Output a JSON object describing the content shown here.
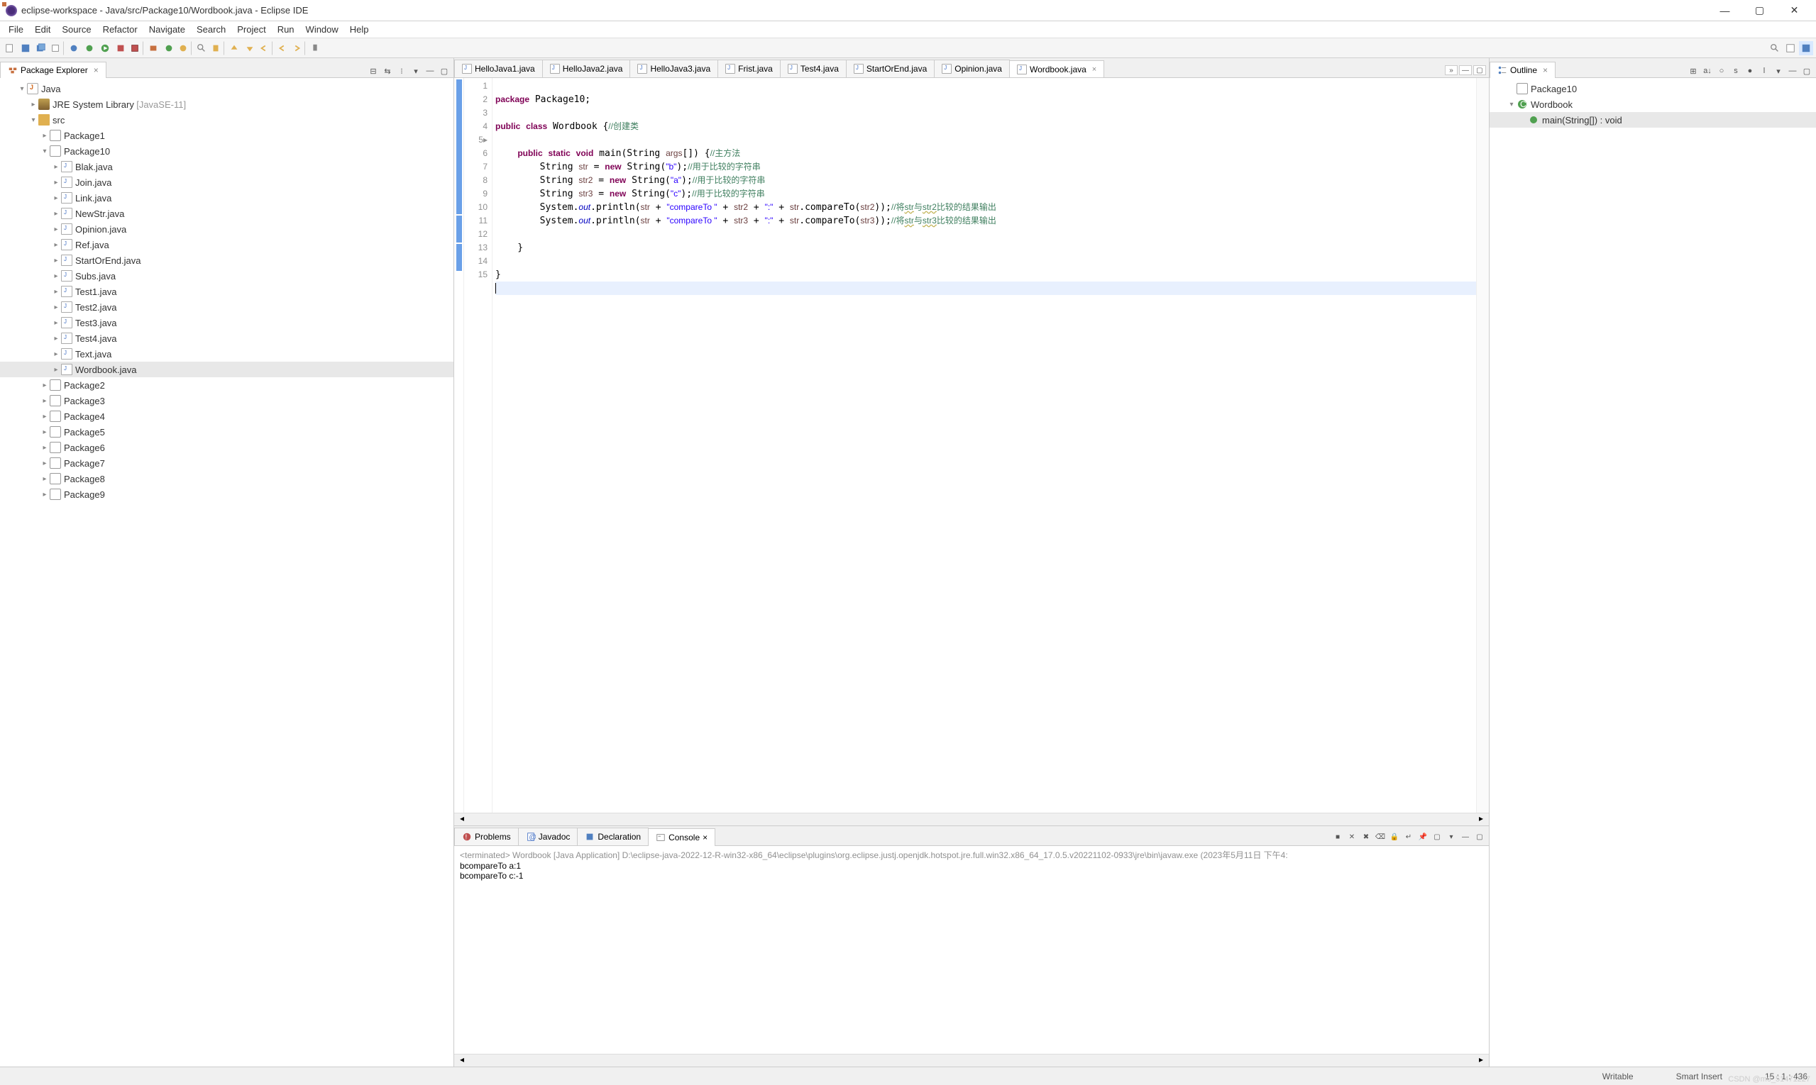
{
  "titlebar": {
    "title": "eclipse-workspace - Java/src/Package10/Wordbook.java - Eclipse IDE"
  },
  "menubar": [
    "File",
    "Edit",
    "Source",
    "Refactor",
    "Navigate",
    "Search",
    "Project",
    "Run",
    "Window",
    "Help"
  ],
  "package_explorer": {
    "title": "Package Explorer",
    "project": "Java",
    "jre": {
      "label": "JRE System Library",
      "suffix": "[JavaSE-11]"
    },
    "src": "src",
    "packages_above": [
      "Package1"
    ],
    "open_package": "Package10",
    "files": [
      "Blak.java",
      "Join.java",
      "Link.java",
      "NewStr.java",
      "Opinion.java",
      "Ref.java",
      "StartOrEnd.java",
      "Subs.java",
      "Test1.java",
      "Test2.java",
      "Test3.java",
      "Test4.java",
      "Text.java",
      "Wordbook.java"
    ],
    "selected_file": "Wordbook.java",
    "packages_below": [
      "Package2",
      "Package3",
      "Package4",
      "Package5",
      "Package6",
      "Package7",
      "Package8",
      "Package9"
    ]
  },
  "editor_tabs": [
    "HelloJava1.java",
    "HelloJava2.java",
    "HelloJava3.java",
    "Frist.java",
    "Test4.java",
    "StartOrEnd.java",
    "Opinion.java",
    "Wordbook.java"
  ],
  "active_tab": "Wordbook.java",
  "code": {
    "line1": "package Package10;",
    "line3a": "public",
    "line3b": "class",
    "line3c": "Wordbook {",
    "line3cmt": "//创建类",
    "line5a": "public static void",
    "line5b": "main(String ",
    "line5c": "args",
    "line5d": "[]) {",
    "line5cmt": "//主方法",
    "line6a": "String ",
    "line6v": "str",
    "line6b": " = ",
    "line6c": "new",
    "line6d": " String(",
    "line6s": "\"b\"",
    "line6e": ");",
    "line6cmt": "//用于比较的字符串",
    "line7a": "String ",
    "line7v": "str2",
    "line7b": " = ",
    "line7c": "new",
    "line7d": " String(",
    "line7s": "\"a\"",
    "line7e": ");",
    "line7cmt": "//用于比较的字符串",
    "line8a": "String ",
    "line8v": "str3",
    "line8b": " = ",
    "line8c": "new",
    "line8d": " String(",
    "line8s": "\"c\"",
    "line8e": ");",
    "line8cmt": "//用于比较的字符串",
    "line9a": "System.",
    "line9b": "out",
    "line9c": ".println(",
    "line9v1": "str",
    "line9d": " + ",
    "line9s": "\"compareTo \"",
    "line9e": " + ",
    "line9v2": "str2",
    "line9f": " + ",
    "line9s2": "\":\"",
    "line9g": " + ",
    "line9v3": "str",
    "line9h": ".compareTo(",
    "line9v4": "str2",
    "line9i": "));",
    "line9cmt": "//将str与str2比较的结果输出",
    "line10a": "System.",
    "line10b": "out",
    "line10c": ".println(",
    "line10v1": "str",
    "line10d": " + ",
    "line10s": "\"compareTo \"",
    "line10e": " + ",
    "line10v2": "str3",
    "line10f": " + ",
    "line10s2": "\":\"",
    "line10g": " + ",
    "line10v3": "str",
    "line10h": ".compareTo(",
    "line10v4": "str3",
    "line10i": "));",
    "line10cmt": "//将str与str3比较的结果输出",
    "line12": "}",
    "line14": "}",
    "line15": ""
  },
  "line_numbers": [
    "1",
    "2",
    "3",
    "4",
    "5",
    "6",
    "7",
    "8",
    "9",
    "10",
    "11",
    "12",
    "13",
    "14",
    "15"
  ],
  "outline": {
    "title": "Outline",
    "pkg": "Package10",
    "cls": "Wordbook",
    "method": "main(String[]) : void"
  },
  "bottom_tabs": [
    "Problems",
    "Javadoc",
    "Declaration",
    "Console"
  ],
  "active_bottom_tab": "Console",
  "console": {
    "header": "<terminated> Wordbook [Java Application] D:\\eclipse-java-2022-12-R-win32-x86_64\\eclipse\\plugins\\org.eclipse.justj.openjdk.hotspot.jre.full.win32.x86_64_17.0.5.v20221102-0933\\jre\\bin\\javaw.exe  (2023年5月11日 下午4:",
    "line1": "bcompareTo a:1",
    "line2": "bcompareTo c:-1"
  },
  "statusbar": {
    "writable": "Writable",
    "insert": "Smart Insert",
    "pos": "15 : 1 : 436"
  },
  "watermark": "CSDN @m0_51471227"
}
